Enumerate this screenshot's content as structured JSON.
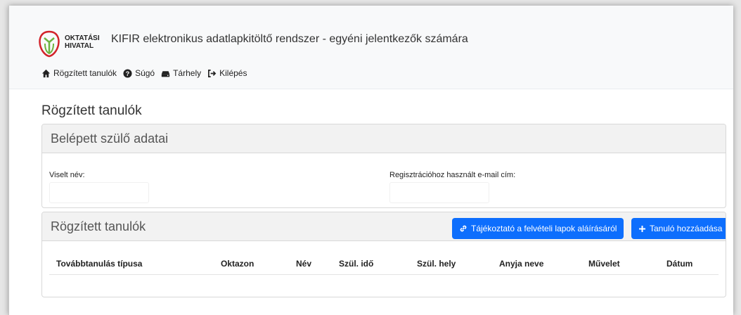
{
  "header": {
    "logo_line1": "OKTATÁSI",
    "logo_line2": "HIVATAL",
    "app_title": "KIFIR elektronikus adatlapkitöltő rendszer - egyéni jelentkezők számára",
    "nav": [
      {
        "label": "Rögzített tanulók",
        "icon": "home-icon"
      },
      {
        "label": "Súgó",
        "icon": "help-circle-icon"
      },
      {
        "label": "Tárhely",
        "icon": "hdd-icon"
      },
      {
        "label": "Kilépés",
        "icon": "sign-out-icon"
      }
    ]
  },
  "page_title": "Rögzített tanulók",
  "parent_card": {
    "title": "Belépett szülő adatai",
    "name_label": "Viselt név:",
    "name_value": "",
    "email_label": "Regisztrációhoz használt e-mail cím:",
    "email_value": ""
  },
  "students_card": {
    "title": "Rögzített tanulók",
    "info_button": "Tájékoztató a felvételi lapok aláírásáról",
    "add_button": "Tanuló hozzáadása",
    "columns": [
      "Továbbtanulás típusa",
      "Oktazon",
      "Név",
      "Szül. idő",
      "Szül. hely",
      "Anyja neve",
      "Művelet",
      "Dátum"
    ]
  },
  "colors": {
    "primary": "#0d6efd",
    "logo_green": "#6cb33f",
    "logo_red": "#d2232a"
  }
}
